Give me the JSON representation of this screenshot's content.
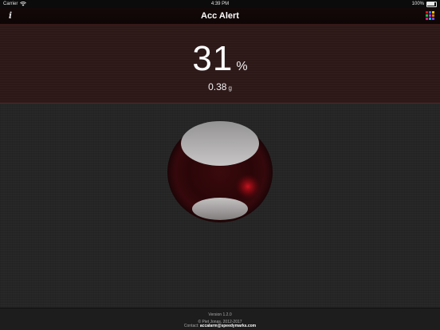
{
  "status_bar": {
    "carrier": "Carrier",
    "time": "4:39 PM",
    "battery": "100%",
    "battery_level": 1.0
  },
  "nav": {
    "title": "Acc Alert",
    "info_glyph": "i",
    "left_icon": "info-icon",
    "right_icon": "color-grid-icon"
  },
  "readout": {
    "percent_value": "31",
    "percent_unit": "%",
    "g_value": "0.38",
    "g_unit": "g"
  },
  "footer": {
    "version": "Version 1.2.0",
    "copyright": "© Piet Jonas, 2012-2017",
    "contact_label": "Contact:",
    "contact_email": "accalarm@speedymarks.com"
  },
  "colors": {
    "accent_red": "#c0121b",
    "panel": "#2d1818",
    "background": "#252525",
    "grid_cells": [
      "#e0141c",
      "#3a6df0",
      "#f5c400",
      "#2fb84a",
      "#b234e0",
      "#f07a1a",
      "#e01a8a",
      "#1ab8c8",
      "#7a4af0"
    ]
  }
}
